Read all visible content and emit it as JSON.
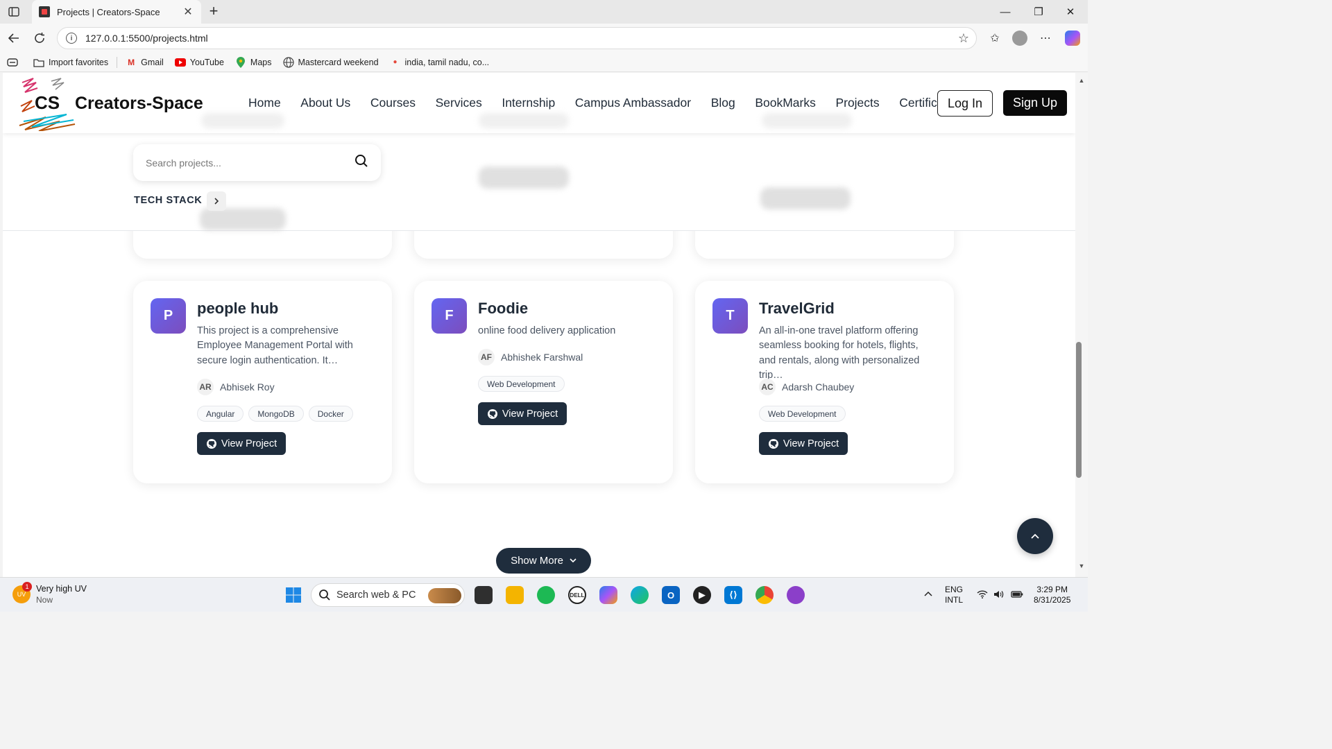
{
  "browser": {
    "tab_title": "Projects | Creators-Space",
    "url": "127.0.0.1:5500/projects.html",
    "favorites": [
      {
        "label": "Import favorites",
        "icon": "folder-import-icon"
      },
      {
        "label": "Gmail",
        "icon": "gmail-icon"
      },
      {
        "label": "YouTube",
        "icon": "youtube-icon"
      },
      {
        "label": "Maps",
        "icon": "maps-pin-icon"
      },
      {
        "label": "Mastercard weekend",
        "icon": "globe-icon"
      },
      {
        "label": "india, tamil nadu, co...",
        "icon": "flame-icon"
      }
    ]
  },
  "site": {
    "logo_mark": "CS",
    "logo_text": "Creators-Space",
    "nav": [
      "Home",
      "About Us",
      "Courses",
      "Services",
      "Internship",
      "Campus Ambassador",
      "Blog",
      "BookMarks",
      "Projects",
      "Certificates"
    ],
    "login": "Log In",
    "signup": "Sign Up"
  },
  "filters": {
    "search_placeholder": "Search projects...",
    "tech_stack_label": "TECH STACK"
  },
  "projects": [
    {
      "letter": "P",
      "title": "people hub",
      "description": "This project is a comprehensive Employee Management Portal with secure login authentication. It…",
      "author_initials": "AR",
      "author": "Abhisek Roy",
      "tags": [
        "Angular",
        "MongoDB",
        "Docker"
      ],
      "button": "View Project"
    },
    {
      "letter": "F",
      "title": "Foodie",
      "description": "online food delivery application",
      "author_initials": "AF",
      "author": "Abhishek Farshwal",
      "tags": [
        "Web Development"
      ],
      "button": "View Project"
    },
    {
      "letter": "T",
      "title": "TravelGrid",
      "description": "An all-in-one travel platform offering seamless booking for hotels, flights, and rentals, along with personalized trip…",
      "author_initials": "AC",
      "author": "Adarsh Chaubey",
      "tags": [
        "Web Development"
      ],
      "button": "View Project"
    }
  ],
  "show_more": "Show More",
  "taskbar": {
    "weather_title": "Very high UV",
    "weather_sub": "Now",
    "weather_badge": "1",
    "weather_icon_text": "UV",
    "search_label": "Search web & PC",
    "lang_1": "ENG",
    "lang_2": "INTL",
    "time": "3:29 PM",
    "date": "8/31/2025"
  },
  "colors": {
    "accent_dark": "#1f2d3d",
    "avatar_gradient_start": "#6366f1",
    "avatar_gradient_end": "#7c4dbd"
  }
}
